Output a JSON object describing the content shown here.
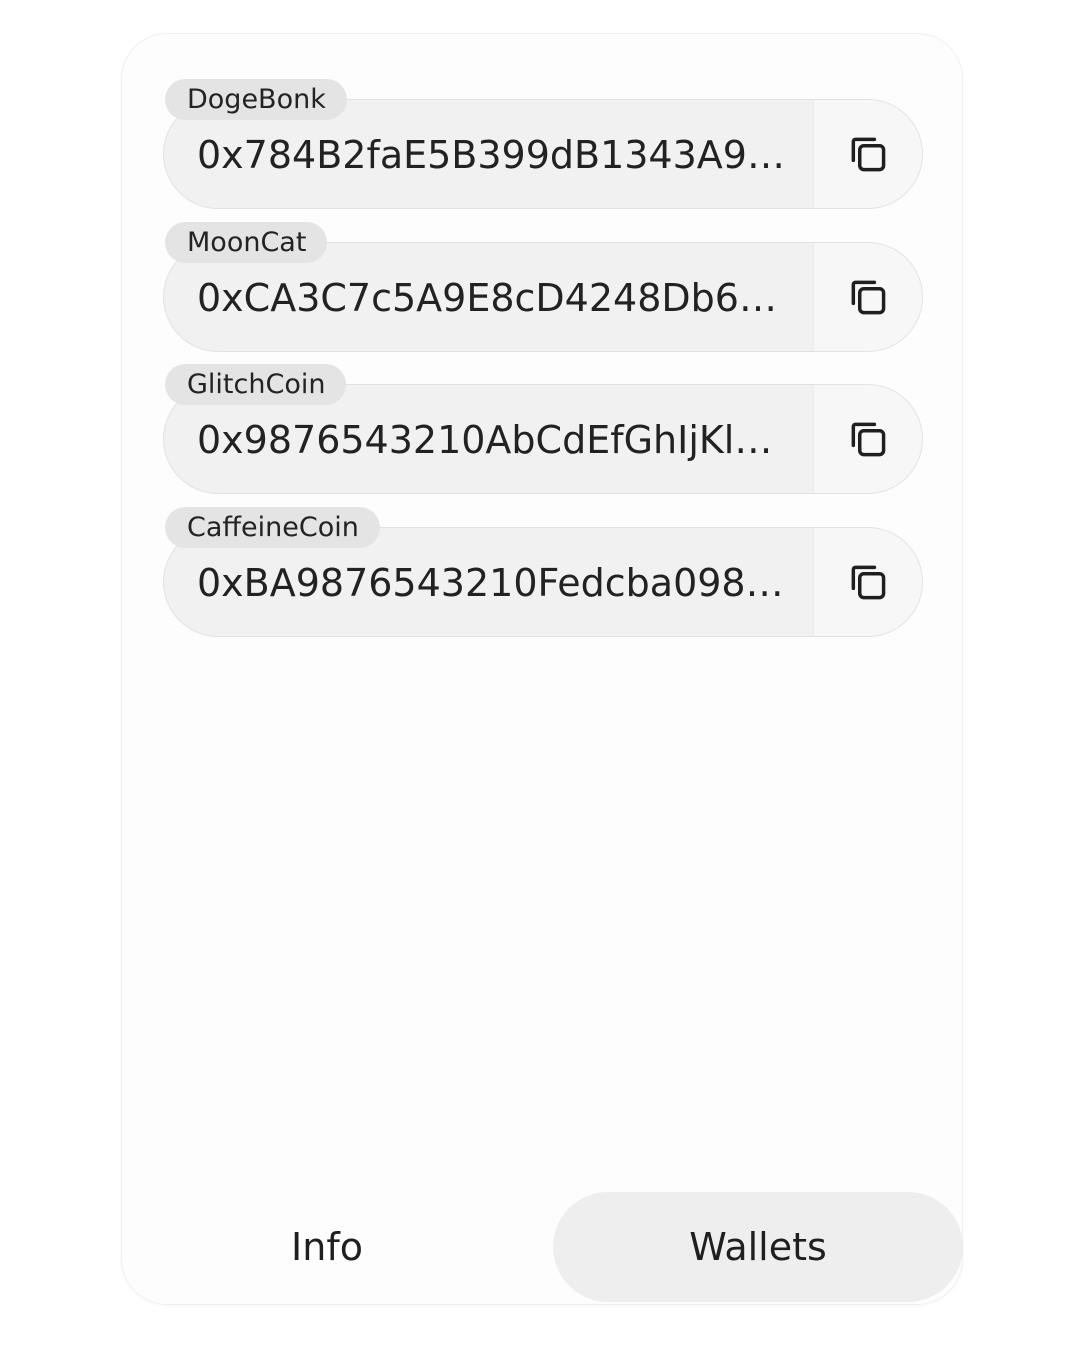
{
  "wallets": [
    {
      "name": "DogeBonk",
      "address": "0x784B2faE5B399dB1343A98..."
    },
    {
      "name": "MoonCat",
      "address": "0xCA3C7c5A9E8cD4248Db64..."
    },
    {
      "name": "GlitchCoin",
      "address": "0x9876543210AbCdEfGhIjKlM..."
    },
    {
      "name": "CaffeineCoin",
      "address": "0xBA9876543210Fedcba0987..."
    }
  ],
  "tabs": {
    "info_label": "Info",
    "wallets_label": "Wallets",
    "active": "Wallets"
  },
  "icons": {
    "copy": "copy-icon"
  }
}
